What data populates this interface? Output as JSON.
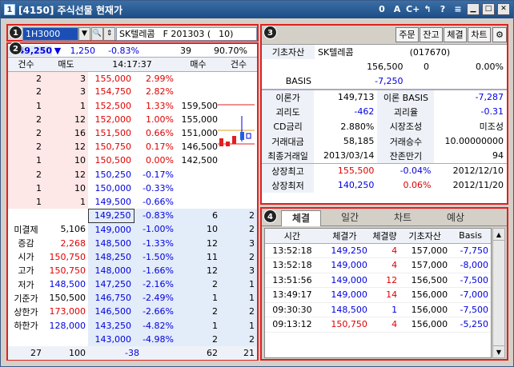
{
  "window": {
    "title": "[4150] 주식선물 현재가",
    "app_badge": "1"
  },
  "titlebar_icons": [
    "0",
    "A",
    "C+",
    "↰",
    "?",
    "≡"
  ],
  "badges": [
    "1",
    "2",
    "3",
    "4"
  ],
  "search": {
    "code": "1H3000",
    "name_label": "SK텔레콤",
    "contract": "F 201303 (",
    "days": "10)"
  },
  "quote": {
    "price": "149,250",
    "arrow": "▼",
    "change": "1,250",
    "change_pct": "-0.83%",
    "volume": "39",
    "volume_pct": "90.70%"
  },
  "orderbook": {
    "headers": [
      "건수",
      "매도",
      "14:17:37",
      "",
      "매수",
      "건수"
    ],
    "asks": [
      {
        "cnt": "2",
        "qty": "3",
        "price": "155,000",
        "pct": "2.99%"
      },
      {
        "cnt": "2",
        "qty": "3",
        "price": "154,750",
        "pct": "2.82%"
      },
      {
        "cnt": "1",
        "qty": "1",
        "price": "152,500",
        "pct": "1.33%"
      },
      {
        "cnt": "2",
        "qty": "12",
        "price": "152,000",
        "pct": "1.00%"
      },
      {
        "cnt": "2",
        "qty": "16",
        "price": "151,500",
        "pct": "0.66%"
      },
      {
        "cnt": "2",
        "qty": "12",
        "price": "150,750",
        "pct": "0.17%"
      },
      {
        "cnt": "1",
        "qty": "10",
        "price": "150,500",
        "pct": "0.00%"
      },
      {
        "cnt": "2",
        "qty": "12",
        "price": "150,250",
        "pct": "-0.17%"
      },
      {
        "cnt": "1",
        "qty": "10",
        "price": "150,000",
        "pct": "-0.33%"
      },
      {
        "cnt": "1",
        "qty": "1",
        "price": "149,500",
        "pct": "-0.66%"
      }
    ],
    "bids": [
      {
        "price": "149,250",
        "pct": "-0.83%",
        "qty": "6",
        "cnt": "2"
      },
      {
        "price": "149,000",
        "pct": "-1.00%",
        "qty": "10",
        "cnt": "2"
      },
      {
        "price": "148,500",
        "pct": "-1.33%",
        "qty": "12",
        "cnt": "3"
      },
      {
        "price": "148,250",
        "pct": "-1.50%",
        "qty": "11",
        "cnt": "2"
      },
      {
        "price": "148,000",
        "pct": "-1.66%",
        "qty": "12",
        "cnt": "3"
      },
      {
        "price": "147,250",
        "pct": "-2.16%",
        "qty": "2",
        "cnt": "1"
      },
      {
        "price": "146,750",
        "pct": "-2.49%",
        "qty": "1",
        "cnt": "1"
      },
      {
        "price": "146,500",
        "pct": "-2.66%",
        "qty": "2",
        "cnt": "2"
      },
      {
        "price": "143,250",
        "pct": "-4.82%",
        "qty": "1",
        "cnt": "1"
      },
      {
        "price": "143,000",
        "pct": "-4.98%",
        "qty": "2",
        "cnt": "2"
      }
    ],
    "mini_chart_prices": [
      "159,500",
      "155,000",
      "151,000",
      "146,500",
      "142,500"
    ],
    "left_info": [
      {
        "label": "미결제",
        "value": "5,106"
      },
      {
        "label": "증감",
        "value": "2,268"
      },
      {
        "label": "시가",
        "value": "150,750"
      },
      {
        "label": "고가",
        "value": "150,750"
      },
      {
        "label": "저가",
        "value": "148,500"
      },
      {
        "label": "기준가",
        "value": "150,500"
      },
      {
        "label": "상한가",
        "value": "173,000"
      },
      {
        "label": "하한가",
        "value": "128,000"
      }
    ],
    "footer": [
      "27",
      "100",
      "-38",
      "62",
      "21"
    ]
  },
  "toolbar": {
    "buttons": [
      "주문",
      "잔고",
      "체결",
      "차트"
    ]
  },
  "info": {
    "underlying_label": "기초자산",
    "underlying_name": "SK텔레콤",
    "underlying_code": "(017670)",
    "underlying_price": "156,500",
    "underlying_change": "0",
    "underlying_pct": "0.00%",
    "basis_label": "BASIS",
    "basis_value": "-7,250",
    "rows": [
      {
        "l1": "이론가",
        "v1": "149,713",
        "l2": "이론 BASIS",
        "v2": "-7,287"
      },
      {
        "l1": "괴리도",
        "v1": "-462",
        "l2": "괴리율",
        "v2": "-0.31"
      },
      {
        "l1": "CD금리",
        "v1": "2.880%",
        "l2": "시장조성",
        "v2": "미조성"
      },
      {
        "l1": "거래대금",
        "v1": "58,185",
        "l2": "거래승수",
        "v2": "10.00000000"
      },
      {
        "l1": "최종거래일",
        "v1": "2013/03/14",
        "l2": "잔존만기",
        "v2": "94"
      }
    ],
    "limits": [
      {
        "label": "상장최고",
        "price": "155,500",
        "pct": "-0.04%",
        "date": "2012/12/10"
      },
      {
        "label": "상장최저",
        "price": "140,250",
        "pct": "0.06%",
        "date": "2012/11/20"
      }
    ]
  },
  "tabs": [
    "체결",
    "일간",
    "차트",
    "예상"
  ],
  "trades": {
    "headers": [
      "시간",
      "체결가",
      "체결량",
      "기초자산",
      "Basis"
    ],
    "rows": [
      [
        "13:52:18",
        "149,250",
        "4",
        "157,000",
        "-7,750"
      ],
      [
        "13:52:18",
        "149,000",
        "4",
        "157,000",
        "-8,000"
      ],
      [
        "13:51:56",
        "149,000",
        "12",
        "156,500",
        "-7,500"
      ],
      [
        "13:49:17",
        "149,000",
        "14",
        "156,000",
        "-7,000"
      ],
      [
        "09:30:30",
        "148,500",
        "1",
        "156,000",
        "-7,500"
      ],
      [
        "09:13:12",
        "150,750",
        "4",
        "156,000",
        "-5,250"
      ]
    ]
  }
}
